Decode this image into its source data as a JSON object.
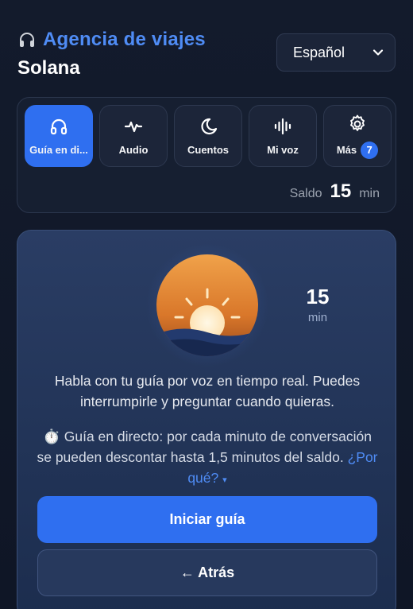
{
  "header": {
    "title": "Agencia de viajes",
    "subtitle": "Solana",
    "title_icon": "headphone-icon",
    "language_selected": "Español"
  },
  "tabs": [
    {
      "label": "Guía en di...",
      "icon": "headphones-icon",
      "active": true
    },
    {
      "label": "Audio",
      "icon": "waveform-icon",
      "active": false
    },
    {
      "label": "Cuentos",
      "icon": "moon-icon",
      "active": false
    },
    {
      "label": "Mi voz",
      "icon": "voice-bars-icon",
      "active": false
    },
    {
      "label": "Más",
      "icon": "gear-icon",
      "active": false,
      "badge": "7"
    }
  ],
  "balance": {
    "label": "Saldo",
    "value": "15",
    "unit": "min"
  },
  "guide": {
    "timer_value": "15",
    "timer_unit": "min",
    "description": "Habla con tu guía por voz en tiempo real. Puedes interrumpirle y preguntar cuando quieras.",
    "note_icon": "⏱️",
    "note_text": "Guía en directo: por cada minuto de conversación se pueden descontar hasta 1,5 minutos del saldo.",
    "why_link": "¿Por qué?",
    "why_caret": "▾",
    "start_button": "Iniciar guía",
    "back_button": "← Atrás"
  },
  "colors": {
    "accent": "#2f6ff0",
    "title_blue": "#4f8cf5",
    "background": "#131b2c",
    "sun_orange": "#e98a2c"
  }
}
